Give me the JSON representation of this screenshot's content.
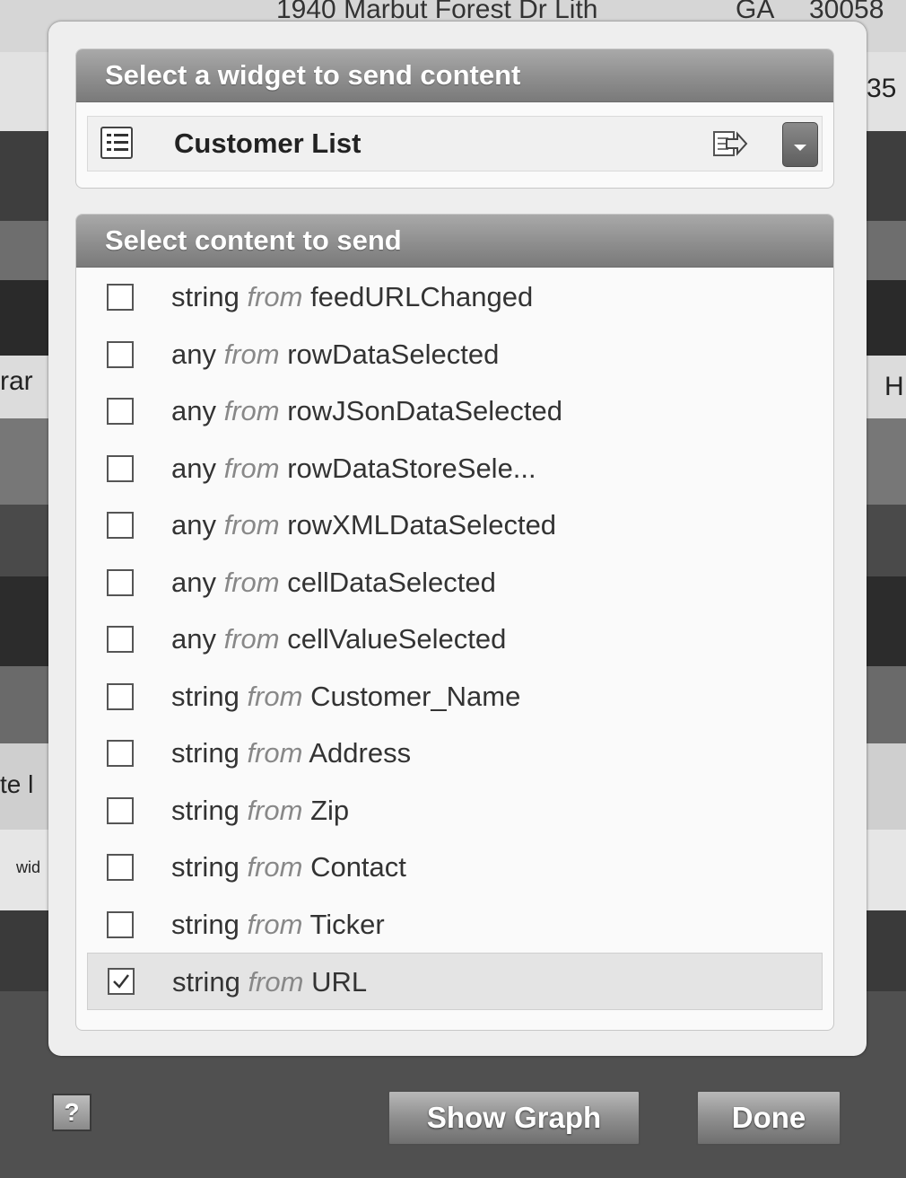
{
  "background": {
    "address_line": "1940 Marbut Forest Dr Lith",
    "state": "GA",
    "zip": "30058",
    "fragment_right": "35",
    "fragment_left1": "rar",
    "fragment_right1": "H",
    "fragment_left2": "te l",
    "fragment_left3": "wid"
  },
  "widget_panel": {
    "title": "Select a widget to send content",
    "selected_widget": "Customer List"
  },
  "content_panel": {
    "title": "Select content to send",
    "from_word": "from",
    "items": [
      {
        "type": "string",
        "source": "feedURLChanged",
        "checked": false
      },
      {
        "type": "any",
        "source": "rowDataSelected",
        "checked": false
      },
      {
        "type": "any",
        "source": "rowJSonDataSelected",
        "checked": false
      },
      {
        "type": "any",
        "source": "rowDataStoreSele...",
        "checked": false
      },
      {
        "type": "any",
        "source": "rowXMLDataSelected",
        "checked": false
      },
      {
        "type": "any",
        "source": "cellDataSelected",
        "checked": false
      },
      {
        "type": "any",
        "source": "cellValueSelected",
        "checked": false
      },
      {
        "type": "string",
        "source": "Customer_Name",
        "checked": false
      },
      {
        "type": "string",
        "source": "Address",
        "checked": false
      },
      {
        "type": "string",
        "source": "Zip",
        "checked": false
      },
      {
        "type": "string",
        "source": "Contact",
        "checked": false
      },
      {
        "type": "string",
        "source": "Ticker",
        "checked": false
      },
      {
        "type": "string",
        "source": "URL",
        "checked": true
      }
    ]
  },
  "footer": {
    "help_label": "?",
    "show_graph_label": "Show Graph",
    "done_label": "Done"
  }
}
